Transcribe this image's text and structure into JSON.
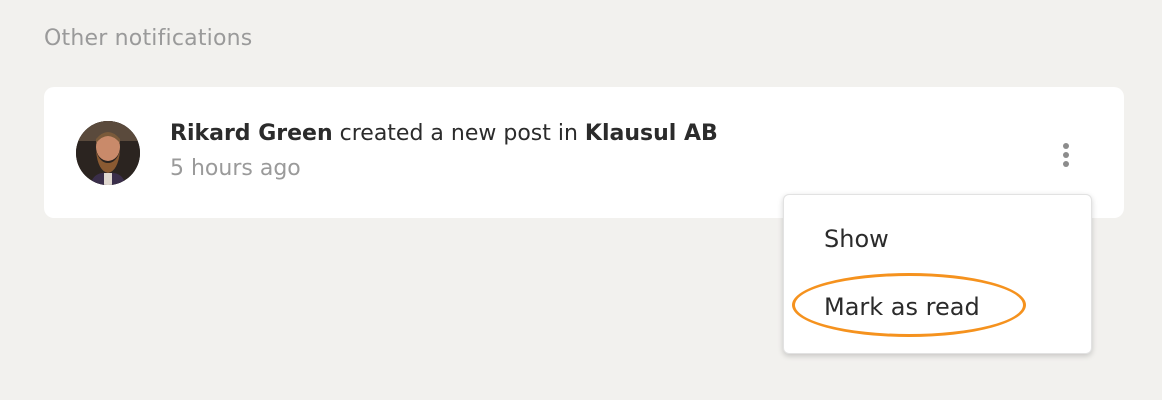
{
  "section": {
    "title": "Other notifications"
  },
  "notification": {
    "actor": "Rikard Green",
    "action": " created a new post in ",
    "target": "Klausul AB",
    "time": "5 hours ago",
    "avatar_icon": "user-avatar-photo",
    "menu_icon": "kebab-menu-icon"
  },
  "dropdown": {
    "items": [
      {
        "label": "Show"
      },
      {
        "label": "Mark as read"
      }
    ]
  },
  "colors": {
    "background": "#f2f1ee",
    "card": "#ffffff",
    "highlight": "#f5921e",
    "muted_text": "#9a9a9a"
  }
}
